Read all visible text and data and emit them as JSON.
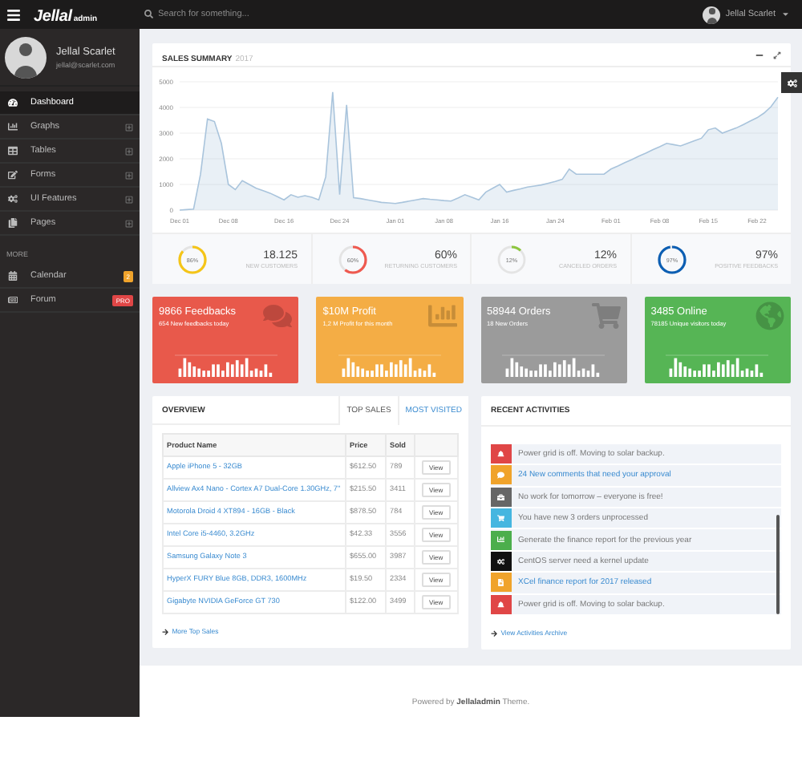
{
  "topbar": {
    "logo_main": "Jellal",
    "logo_sub": "admin",
    "search": {
      "placeholder": "Search for something..."
    },
    "user": {
      "name": "Jellal Scarlet"
    }
  },
  "sidebar": {
    "profile": {
      "name": "Jellal Scarlet",
      "email": "jellal@scarlet.com"
    },
    "items": [
      {
        "kind": "dashboard",
        "label": "Dashboard",
        "selected": true,
        "expandable": false
      },
      {
        "kind": "graphs",
        "label": "Graphs",
        "selected": false,
        "expandable": true
      },
      {
        "kind": "tables",
        "label": "Tables",
        "selected": false,
        "expandable": true
      },
      {
        "kind": "forms",
        "label": "Forms",
        "selected": false,
        "expandable": true
      },
      {
        "kind": "features",
        "label": "UI Features",
        "selected": false,
        "expandable": true
      },
      {
        "kind": "pages",
        "label": "Pages",
        "selected": false,
        "expandable": true
      }
    ],
    "section_label": "MORE",
    "more_items": [
      {
        "kind": "calendar",
        "label": "Calendar",
        "badge": "2",
        "color": "#f0a32b",
        "selected": false
      },
      {
        "kind": "forum",
        "label": "Forum",
        "badge": "PRO",
        "color": "#e04646",
        "selected": false
      }
    ]
  },
  "sales_summary": {
    "title": "SALES SUMMARY",
    "year": "2017",
    "chart_data": {
      "type": "area",
      "categories": [
        "Dec 01",
        null,
        null,
        null,
        null,
        null,
        null,
        "Dec 08",
        null,
        null,
        null,
        null,
        null,
        null,
        null,
        "Dec 16",
        null,
        null,
        null,
        null,
        null,
        null,
        null,
        "Dec 24",
        null,
        null,
        null,
        null,
        null,
        null,
        null,
        "Jan 01",
        null,
        null,
        null,
        null,
        null,
        null,
        "Jan 08",
        null,
        null,
        null,
        null,
        null,
        null,
        null,
        "Jan 16",
        null,
        null,
        null,
        null,
        null,
        null,
        null,
        "Jan 24",
        null,
        null,
        null,
        null,
        null,
        null,
        null,
        "Feb 01",
        null,
        null,
        null,
        null,
        null,
        null,
        "Feb 08",
        null,
        null,
        null,
        null,
        null,
        null,
        "Feb 15",
        null,
        null,
        null,
        null,
        null,
        null,
        "Feb 22",
        null,
        null,
        null
      ],
      "series": [
        {
          "color": "#a9c4dc",
          "values": [
            0,
            20,
            40,
            1400,
            3550,
            3450,
            2600,
            1000,
            800,
            1150,
            1000,
            850,
            760,
            660,
            530,
            400,
            600,
            500,
            560,
            500,
            400,
            1300,
            4600,
            600,
            4100,
            480,
            450,
            400,
            350,
            300,
            280,
            260,
            300,
            350,
            400,
            450,
            420,
            400,
            370,
            350,
            470,
            600,
            500,
            400,
            700,
            850,
            1000,
            700,
            770,
            830,
            900,
            940,
            980,
            1050,
            1120,
            1200,
            1600,
            1400,
            1400,
            1400,
            1400,
            1400,
            1600,
            1720,
            1850,
            1970,
            2100,
            2220,
            2350,
            2470,
            2600,
            2550,
            2500,
            2600,
            2700,
            2800,
            3130,
            3200,
            3000,
            3100,
            3200,
            3330,
            3470,
            3600,
            3780,
            4030,
            4400
          ]
        }
      ],
      "ylim": [
        0,
        5000
      ],
      "yticks": [
        0,
        1000,
        2000,
        3000,
        4000,
        5000
      ],
      "grid": true
    },
    "stats": [
      {
        "percent": "86%",
        "color": "#f5c518",
        "value": "18.125",
        "label": "NEW CUSTOMERS"
      },
      {
        "percent": "60%",
        "color": "#ef5a50",
        "value": "60%",
        "label": "RETURNING CUSTOMERS"
      },
      {
        "percent": "12%",
        "color": "#8dc63f",
        "value": "12%",
        "label": "CANCELED ORDERS"
      },
      {
        "percent": "97%",
        "color": "#0d5fb3",
        "value": "97%",
        "label": "POSITIVE FEEDBACKS"
      }
    ]
  },
  "cards": [
    {
      "kind": "comments",
      "title": "9866 Feedbacks",
      "subtitle": "654 New feedbacks today",
      "color": "#e8594b"
    },
    {
      "kind": "chart",
      "title": "$10M Profit",
      "subtitle": "1,2 M Profit for this month",
      "color": "#f4ad45"
    },
    {
      "kind": "cart",
      "title": "58944 Orders",
      "subtitle": "18 New Orders",
      "color": "#9b9b9b"
    },
    {
      "kind": "globe",
      "title": "3485 Online",
      "subtitle": "78185 Unique visitors today",
      "color": "#56b555"
    }
  ],
  "overview": {
    "title": "OVERVIEW",
    "tabs": [
      {
        "label": "TOP SALES",
        "selected": true
      },
      {
        "label": "MOST VISITED",
        "selected": false
      }
    ],
    "columns": [
      "Product Name",
      "Price",
      "Sold"
    ],
    "rows": [
      {
        "name": "Apple iPhone 5 - 32GB",
        "price": "$612.50",
        "sold": "789",
        "action": "View"
      },
      {
        "name": "Allview Ax4 Nano - Cortex A7 Dual-Core 1.30GHz, 7\"",
        "price": "$215.50",
        "sold": "3411",
        "action": "View"
      },
      {
        "name": "Motorola Droid 4 XT894 - 16GB - Black",
        "price": "$878.50",
        "sold": "784",
        "action": "View"
      },
      {
        "name": "Intel Core i5-4460, 3.2GHz",
        "price": "$42.33",
        "sold": "3556",
        "action": "View"
      },
      {
        "name": "Samsung Galaxy Note 3",
        "price": "$655.00",
        "sold": "3987",
        "action": "View"
      },
      {
        "name": "HyperX FURY Blue 8GB, DDR3, 1600MHz",
        "price": "$19.50",
        "sold": "2334",
        "action": "View"
      },
      {
        "name": "Gigabyte NVIDIA GeForce GT 730",
        "price": "$122.00",
        "sold": "3499",
        "action": "View"
      }
    ],
    "more_link": "More Top Sales"
  },
  "activities": {
    "title": "RECENT ACTIVITIES",
    "items": [
      {
        "kind": "bell",
        "color": "#e04646",
        "text": "Power grid is off. Moving to solar backup.",
        "link": false
      },
      {
        "kind": "comment",
        "color": "#f0a32b",
        "text": "24 New comments that need your approval",
        "link": true
      },
      {
        "kind": "briefcase",
        "color": "#666666",
        "text": "No work for tomorrow – everyone is free!",
        "link": false
      },
      {
        "kind": "cart",
        "color": "#45b6e0",
        "text": "You have new 3 orders unprocessed",
        "link": false
      },
      {
        "kind": "chart",
        "color": "#4cae4c",
        "text": "Generate the finance report for the previous year",
        "link": false
      },
      {
        "kind": "cogs",
        "color": "#111111",
        "text": "CentOS server need a kernel update",
        "link": false
      },
      {
        "kind": "file",
        "color": "#f0a32b",
        "text": "XCel finance report for 2017 released",
        "link": true
      },
      {
        "kind": "bell",
        "color": "#e04646",
        "text": "Power grid is off. Moving to solar backup.",
        "link": false
      }
    ],
    "archive_link": "View Activities Archive"
  },
  "footer": {
    "text": "Powered by **Jellaladmin** Theme."
  }
}
